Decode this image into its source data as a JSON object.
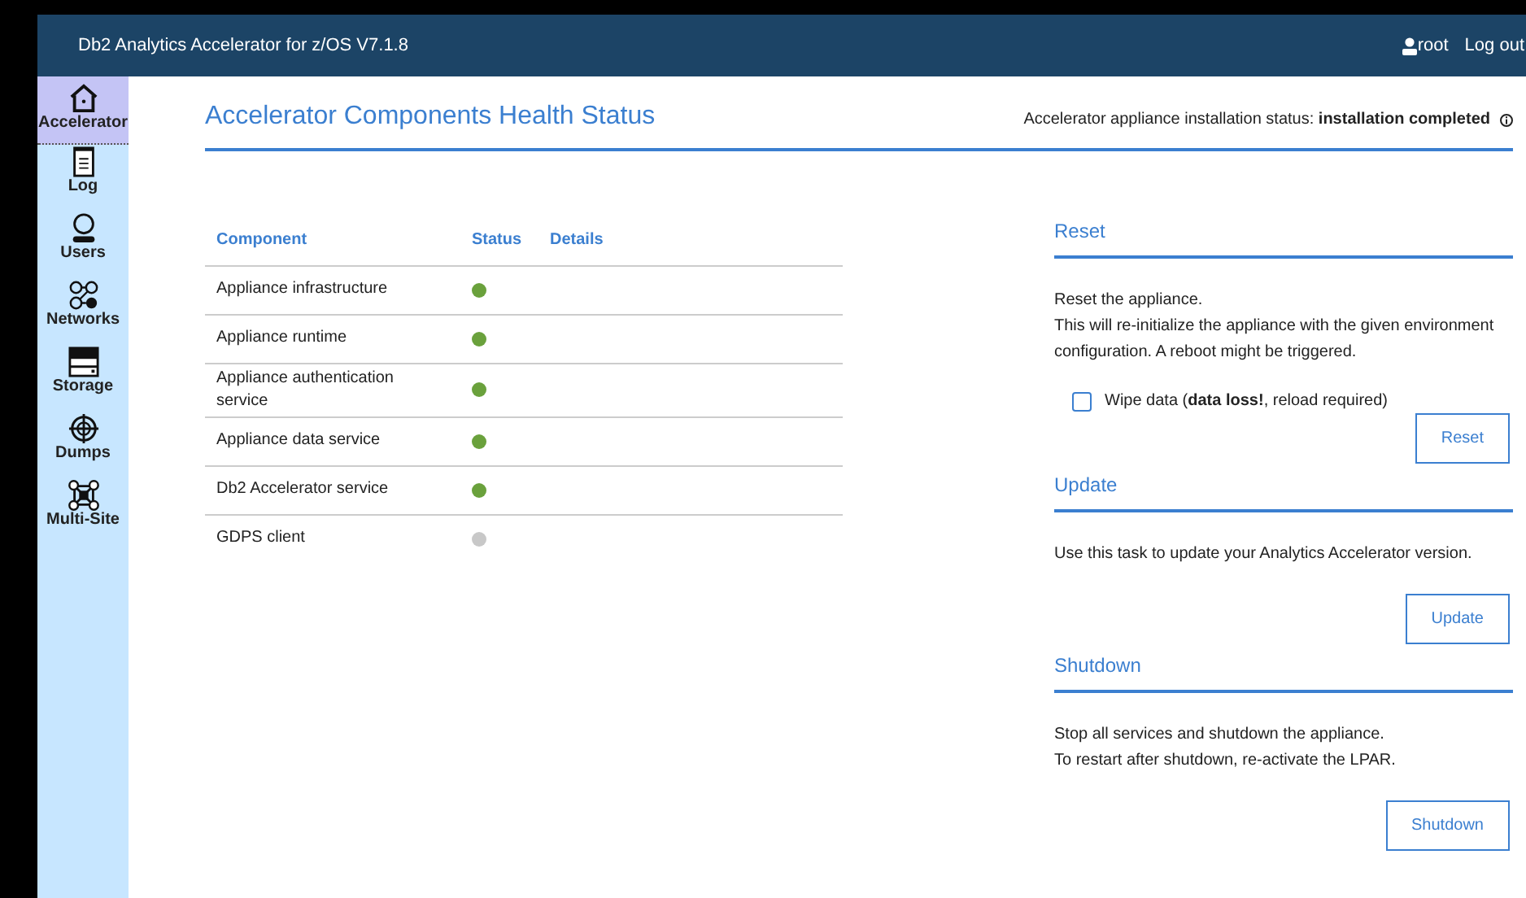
{
  "header": {
    "title": "Db2 Analytics Accelerator for z/OS V7.1.8",
    "user": "root",
    "logout": "Log out"
  },
  "sidebar": {
    "items": [
      {
        "label": "Accelerator",
        "selected": true
      },
      {
        "label": "Log",
        "selected": false
      },
      {
        "label": "Users",
        "selected": false
      },
      {
        "label": "Networks",
        "selected": false
      },
      {
        "label": "Storage",
        "selected": false
      },
      {
        "label": "Dumps",
        "selected": false
      },
      {
        "label": "Multi-Site",
        "selected": false
      }
    ]
  },
  "page_title": "Accelerator Components Health Status",
  "installation_status": {
    "label": "Accelerator appliance installation status:",
    "value": "installation completed"
  },
  "table": {
    "columns": [
      "Component",
      "Status",
      "Details"
    ],
    "rows": [
      {
        "component": "Appliance infrastructure",
        "color": "#6aa13c"
      },
      {
        "component": "Appliance runtime",
        "color": "#6aa13c"
      },
      {
        "component": "Appliance authentication service",
        "color": "#6aa13c"
      },
      {
        "component": "Appliance data service",
        "color": "#6aa13c"
      },
      {
        "component": "Db2 Accelerator service",
        "color": "#6aa13c"
      },
      {
        "component": "GDPS client",
        "color": "#c8c8c8"
      }
    ]
  },
  "sections": [
    {
      "title": "Reset",
      "text": [
        "Reset the appliance.",
        "This will re-initialize the appliance with the given environment configuration. A reboot might be triggered."
      ],
      "checkbox": {
        "label": "Wipe data (**data loss!**, reload required)",
        "checked": false
      },
      "button": "Reset"
    },
    {
      "title": "Update",
      "text": [
        "Use this task to update your Analytics Accelerator version."
      ],
      "button": "Update"
    },
    {
      "title": "Shutdown",
      "text": [
        "Stop all services and shutdown the appliance.",
        "To restart after shutdown, re-activate the LPAR."
      ],
      "button": "Shutdown"
    }
  ]
}
